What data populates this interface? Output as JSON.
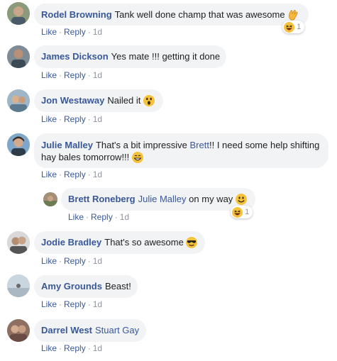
{
  "actions": {
    "like": "Like",
    "reply": "Reply",
    "sep": "·"
  },
  "comments": [
    {
      "author": "Rodel Browning",
      "text": "Tank well done champ that was awesome",
      "time": "1d",
      "reaction_count": "1"
    },
    {
      "author": "James Dickson",
      "text": "Yes mate !!! getting it done",
      "time": "1d"
    },
    {
      "author": "Jon Westaway",
      "text": "Nailed it",
      "time": "1d"
    },
    {
      "author": "Julie Malley",
      "text_before": "That's a bit impressive ",
      "mention": "Brett",
      "text_after": "!! I need some help shifting hay bales tomorrow!!!",
      "time": "1d"
    },
    {
      "author": "Brett Roneberg",
      "mention": "Julie Malley",
      "text": "on my way",
      "time": "1d",
      "reaction_count": "1"
    },
    {
      "author": "Jodie Bradley",
      "text": "That's so awesome",
      "time": "1d"
    },
    {
      "author": "Amy Grounds",
      "text": "Beast!",
      "time": "1d"
    },
    {
      "author": "Darrel West",
      "text": "Stuart Gay",
      "time": "1d"
    }
  ]
}
